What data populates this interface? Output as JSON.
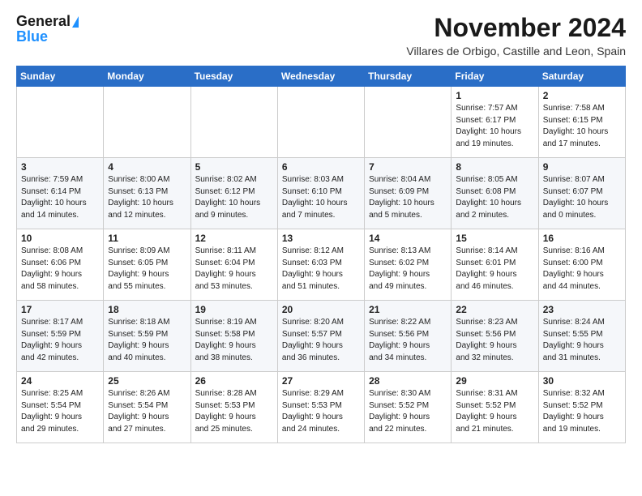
{
  "logo": {
    "line1": "General",
    "line2": "Blue"
  },
  "title": "November 2024",
  "subtitle": "Villares de Orbigo, Castille and Leon, Spain",
  "headers": [
    "Sunday",
    "Monday",
    "Tuesday",
    "Wednesday",
    "Thursday",
    "Friday",
    "Saturday"
  ],
  "weeks": [
    [
      {
        "day": "",
        "info": ""
      },
      {
        "day": "",
        "info": ""
      },
      {
        "day": "",
        "info": ""
      },
      {
        "day": "",
        "info": ""
      },
      {
        "day": "",
        "info": ""
      },
      {
        "day": "1",
        "info": "Sunrise: 7:57 AM\nSunset: 6:17 PM\nDaylight: 10 hours\nand 19 minutes."
      },
      {
        "day": "2",
        "info": "Sunrise: 7:58 AM\nSunset: 6:15 PM\nDaylight: 10 hours\nand 17 minutes."
      }
    ],
    [
      {
        "day": "3",
        "info": "Sunrise: 7:59 AM\nSunset: 6:14 PM\nDaylight: 10 hours\nand 14 minutes."
      },
      {
        "day": "4",
        "info": "Sunrise: 8:00 AM\nSunset: 6:13 PM\nDaylight: 10 hours\nand 12 minutes."
      },
      {
        "day": "5",
        "info": "Sunrise: 8:02 AM\nSunset: 6:12 PM\nDaylight: 10 hours\nand 9 minutes."
      },
      {
        "day": "6",
        "info": "Sunrise: 8:03 AM\nSunset: 6:10 PM\nDaylight: 10 hours\nand 7 minutes."
      },
      {
        "day": "7",
        "info": "Sunrise: 8:04 AM\nSunset: 6:09 PM\nDaylight: 10 hours\nand 5 minutes."
      },
      {
        "day": "8",
        "info": "Sunrise: 8:05 AM\nSunset: 6:08 PM\nDaylight: 10 hours\nand 2 minutes."
      },
      {
        "day": "9",
        "info": "Sunrise: 8:07 AM\nSunset: 6:07 PM\nDaylight: 10 hours\nand 0 minutes."
      }
    ],
    [
      {
        "day": "10",
        "info": "Sunrise: 8:08 AM\nSunset: 6:06 PM\nDaylight: 9 hours\nand 58 minutes."
      },
      {
        "day": "11",
        "info": "Sunrise: 8:09 AM\nSunset: 6:05 PM\nDaylight: 9 hours\nand 55 minutes."
      },
      {
        "day": "12",
        "info": "Sunrise: 8:11 AM\nSunset: 6:04 PM\nDaylight: 9 hours\nand 53 minutes."
      },
      {
        "day": "13",
        "info": "Sunrise: 8:12 AM\nSunset: 6:03 PM\nDaylight: 9 hours\nand 51 minutes."
      },
      {
        "day": "14",
        "info": "Sunrise: 8:13 AM\nSunset: 6:02 PM\nDaylight: 9 hours\nand 49 minutes."
      },
      {
        "day": "15",
        "info": "Sunrise: 8:14 AM\nSunset: 6:01 PM\nDaylight: 9 hours\nand 46 minutes."
      },
      {
        "day": "16",
        "info": "Sunrise: 8:16 AM\nSunset: 6:00 PM\nDaylight: 9 hours\nand 44 minutes."
      }
    ],
    [
      {
        "day": "17",
        "info": "Sunrise: 8:17 AM\nSunset: 5:59 PM\nDaylight: 9 hours\nand 42 minutes."
      },
      {
        "day": "18",
        "info": "Sunrise: 8:18 AM\nSunset: 5:59 PM\nDaylight: 9 hours\nand 40 minutes."
      },
      {
        "day": "19",
        "info": "Sunrise: 8:19 AM\nSunset: 5:58 PM\nDaylight: 9 hours\nand 38 minutes."
      },
      {
        "day": "20",
        "info": "Sunrise: 8:20 AM\nSunset: 5:57 PM\nDaylight: 9 hours\nand 36 minutes."
      },
      {
        "day": "21",
        "info": "Sunrise: 8:22 AM\nSunset: 5:56 PM\nDaylight: 9 hours\nand 34 minutes."
      },
      {
        "day": "22",
        "info": "Sunrise: 8:23 AM\nSunset: 5:56 PM\nDaylight: 9 hours\nand 32 minutes."
      },
      {
        "day": "23",
        "info": "Sunrise: 8:24 AM\nSunset: 5:55 PM\nDaylight: 9 hours\nand 31 minutes."
      }
    ],
    [
      {
        "day": "24",
        "info": "Sunrise: 8:25 AM\nSunset: 5:54 PM\nDaylight: 9 hours\nand 29 minutes."
      },
      {
        "day": "25",
        "info": "Sunrise: 8:26 AM\nSunset: 5:54 PM\nDaylight: 9 hours\nand 27 minutes."
      },
      {
        "day": "26",
        "info": "Sunrise: 8:28 AM\nSunset: 5:53 PM\nDaylight: 9 hours\nand 25 minutes."
      },
      {
        "day": "27",
        "info": "Sunrise: 8:29 AM\nSunset: 5:53 PM\nDaylight: 9 hours\nand 24 minutes."
      },
      {
        "day": "28",
        "info": "Sunrise: 8:30 AM\nSunset: 5:52 PM\nDaylight: 9 hours\nand 22 minutes."
      },
      {
        "day": "29",
        "info": "Sunrise: 8:31 AM\nSunset: 5:52 PM\nDaylight: 9 hours\nand 21 minutes."
      },
      {
        "day": "30",
        "info": "Sunrise: 8:32 AM\nSunset: 5:52 PM\nDaylight: 9 hours\nand 19 minutes."
      }
    ]
  ]
}
